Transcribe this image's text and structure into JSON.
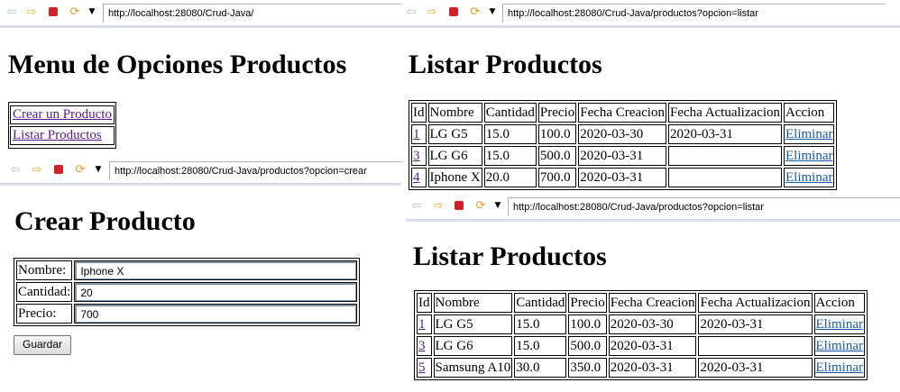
{
  "colors": {
    "stop": "#d0202a",
    "back": "#7c8fa8",
    "link_visited": "#5a1a8c",
    "link": "#1a5aa8"
  },
  "toolbar_icons": [
    "back-arrow-icon",
    "forward-arrow-icon",
    "stop-icon",
    "refresh-icon",
    "dropdown-arrow-icon"
  ],
  "menu": {
    "url": "http://localhost:28080/Crud-Java/",
    "title": "Menu de Opciones Productos",
    "links": [
      "Crear un Producto",
      "Listar Productos"
    ]
  },
  "crear": {
    "url": "http://localhost:28080/Crud-Java/productos?opcion=crear",
    "title": "Crear Producto",
    "fields": [
      {
        "label": "Nombre:",
        "value": "Iphone X"
      },
      {
        "label": "Cantidad:",
        "value": "20"
      },
      {
        "label": "Precio:",
        "value": "700"
      }
    ],
    "submit": "Guardar"
  },
  "listar1": {
    "url": "http://localhost:28080/Crud-Java/productos?opcion=listar",
    "title": "Listar Productos",
    "headers": [
      "Id",
      "Nombre",
      "Cantidad",
      "Precio",
      "Fecha Creacion",
      "Fecha Actualizacion",
      "Accion"
    ],
    "rows": [
      [
        "1",
        "LG G5",
        "15.0",
        "100.0",
        "2020-03-30",
        "2020-03-31",
        "Eliminar"
      ],
      [
        "3",
        "LG G6",
        "15.0",
        "500.0",
        "2020-03-31",
        "",
        "Eliminar"
      ],
      [
        "4",
        "Iphone X",
        "20.0",
        "700.0",
        "2020-03-31",
        "",
        "Eliminar"
      ]
    ]
  },
  "listar2": {
    "url": "http://localhost:28080/Crud-Java/productos?opcion=listar",
    "title": "Listar Productos",
    "headers": [
      "Id",
      "Nombre",
      "Cantidad",
      "Precio",
      "Fecha Creacion",
      "Fecha Actualizacion",
      "Accion"
    ],
    "rows": [
      [
        "1",
        "LG G5",
        "15.0",
        "100.0",
        "2020-03-30",
        "2020-03-31",
        "Eliminar"
      ],
      [
        "3",
        "LG G6",
        "15.0",
        "500.0",
        "2020-03-31",
        "",
        "Eliminar"
      ],
      [
        "5",
        "Samsung A10",
        "30.0",
        "350.0",
        "2020-03-31",
        "2020-03-31",
        "Eliminar"
      ]
    ]
  }
}
